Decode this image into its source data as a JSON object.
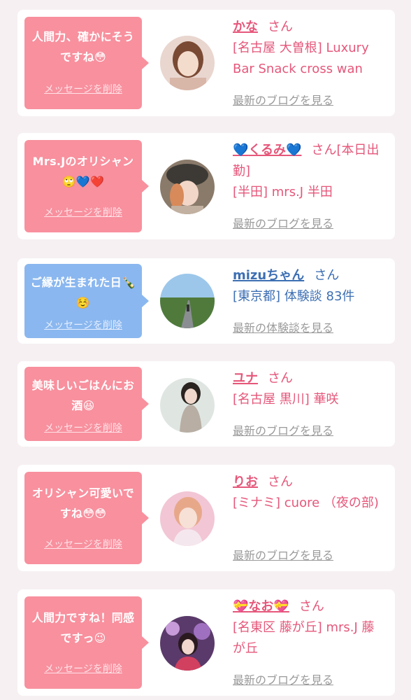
{
  "messages": [
    {
      "bubble_text": "人間力、確かにそうですね😳",
      "delete_label": "メッセージを削除",
      "name": "かな",
      "name_prefix": "",
      "name_suffix": "",
      "honorific": "さん",
      "shop": "[名古屋 大曽根] Luxury Bar Snack cross wan",
      "link_label": "最新のブログを見る",
      "bubble_color": "#f8909e",
      "avatar_icon": "avatar-photo-icon"
    },
    {
      "bubble_text": "Mrs.Jのオリシャン🙄💙❤️",
      "delete_label": "メッセージを削除",
      "name": "くるみ",
      "name_prefix": "💙",
      "name_suffix": "💙",
      "honorific": "さん[本日出勤]",
      "shop": "[半田] mrs.J 半田",
      "link_label": "最新のブログを見る",
      "bubble_color": "#f8909e",
      "avatar_icon": "avatar-photo-icon"
    },
    {
      "bubble_text": "ご縁が生まれた日🍾☺️",
      "delete_label": "メッセージを削除",
      "name": "mizuちゃん",
      "name_prefix": "",
      "name_suffix": "",
      "honorific": "さん",
      "shop": "[東京都] 体験談 83件",
      "link_label": "最新の体験談を見る",
      "bubble_color": "#8ab7ef",
      "avatar_icon": "avatar-road-landscape-icon"
    },
    {
      "bubble_text": "美味しいごはんにお酒😆",
      "delete_label": "メッセージを削除",
      "name": "ユナ",
      "name_prefix": "",
      "name_suffix": "",
      "honorific": "さん",
      "shop": "[名古屋 黒川] 華咲",
      "link_label": "最新のブログを見る",
      "bubble_color": "#f8909e",
      "avatar_icon": "avatar-photo-icon"
    },
    {
      "bubble_text": "オリシャン可愛いですね😳😳",
      "delete_label": "メッセージを削除",
      "name": "りお",
      "name_prefix": "",
      "name_suffix": "",
      "honorific": "さん",
      "shop": "[ミナミ] cuore （夜の部)",
      "link_label": "最新のブログを見る",
      "bubble_color": "#f8909e",
      "avatar_icon": "avatar-photo-icon"
    },
    {
      "bubble_text": "人間力ですね！同感ですっ😉",
      "delete_label": "メッセージを削除",
      "name": "なお",
      "name_prefix": "💝",
      "name_suffix": "💝",
      "honorific": "さん",
      "shop": "[名東区 藤が丘] mrs.J 藤が丘",
      "link_label": "最新のブログを見る",
      "bubble_color": "#f8909e",
      "avatar_icon": "avatar-photo-icon"
    }
  ],
  "colors": {
    "background": "#f6f0f3",
    "pink_accent": "#e5577a",
    "blue_accent": "#3d6fb3",
    "link_gray": "#9a9a9a"
  }
}
